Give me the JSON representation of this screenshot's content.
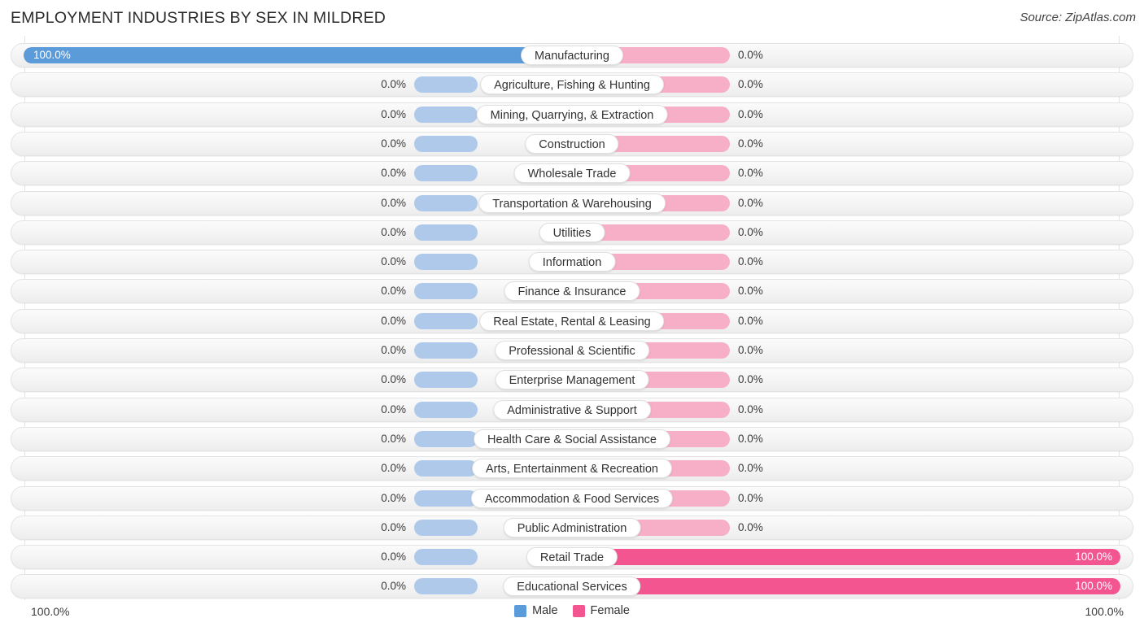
{
  "header": {
    "title": "EMPLOYMENT INDUSTRIES BY SEX IN MILDRED",
    "source": "Source: ZipAtlas.com"
  },
  "footer": {
    "axis_left": "100.0%",
    "axis_right": "100.0%",
    "legend": [
      {
        "label": "Male",
        "color": "#5B9BD9"
      },
      {
        "label": "Female",
        "color": "#F25590"
      }
    ]
  },
  "colors": {
    "male_full": "#5B9BD9",
    "male_stub": "#AFC9EB",
    "female_full": "#F25590",
    "female_stub": "#F7AFC8",
    "track": "#F4F4F4",
    "gridline": "#E4E4E4"
  },
  "chart_data": {
    "type": "bar",
    "subtype": "diverging-bidirectional",
    "title": "EMPLOYMENT INDUSTRIES BY SEX IN MILDRED",
    "xlabel": "",
    "ylabel": "",
    "xlim": [
      100.0,
      100.0
    ],
    "grid": true,
    "legend_position": "bottom-center",
    "axis_left_label": "100.0%",
    "axis_right_label": "100.0%",
    "categories": [
      "Manufacturing",
      "Agriculture, Fishing & Hunting",
      "Mining, Quarrying, & Extraction",
      "Construction",
      "Wholesale Trade",
      "Transportation & Warehousing",
      "Utilities",
      "Information",
      "Finance & Insurance",
      "Real Estate, Rental & Leasing",
      "Professional & Scientific",
      "Enterprise Management",
      "Administrative & Support",
      "Health Care & Social Assistance",
      "Arts, Entertainment & Recreation",
      "Accommodation & Food Services",
      "Public Administration",
      "Retail Trade",
      "Educational Services"
    ],
    "series": [
      {
        "name": "Male",
        "color": "#5B9BD9",
        "values": [
          100.0,
          0.0,
          0.0,
          0.0,
          0.0,
          0.0,
          0.0,
          0.0,
          0.0,
          0.0,
          0.0,
          0.0,
          0.0,
          0.0,
          0.0,
          0.0,
          0.0,
          0.0,
          0.0
        ],
        "labels": [
          "100.0%",
          "0.0%",
          "0.0%",
          "0.0%",
          "0.0%",
          "0.0%",
          "0.0%",
          "0.0%",
          "0.0%",
          "0.0%",
          "0.0%",
          "0.0%",
          "0.0%",
          "0.0%",
          "0.0%",
          "0.0%",
          "0.0%",
          "0.0%",
          "0.0%"
        ]
      },
      {
        "name": "Female",
        "color": "#F25590",
        "values": [
          0.0,
          0.0,
          0.0,
          0.0,
          0.0,
          0.0,
          0.0,
          0.0,
          0.0,
          0.0,
          0.0,
          0.0,
          0.0,
          0.0,
          0.0,
          0.0,
          0.0,
          100.0,
          100.0
        ],
        "labels": [
          "0.0%",
          "0.0%",
          "0.0%",
          "0.0%",
          "0.0%",
          "0.0%",
          "0.0%",
          "0.0%",
          "0.0%",
          "0.0%",
          "0.0%",
          "0.0%",
          "0.0%",
          "0.0%",
          "0.0%",
          "0.0%",
          "0.0%",
          "100.0%",
          "100.0%"
        ]
      }
    ]
  }
}
